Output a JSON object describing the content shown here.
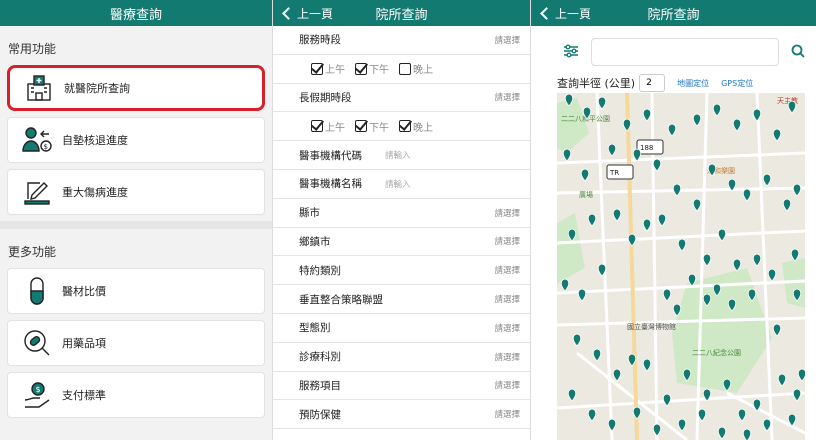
{
  "panel1": {
    "title": "醫療查詢",
    "common_title": "常用功能",
    "common_items": [
      {
        "label": "就醫院所查詢"
      },
      {
        "label": "自墊核退進度"
      },
      {
        "label": "重大傷病進度"
      }
    ],
    "more_title": "更多功能",
    "more_items": [
      {
        "label": "醫材比價"
      },
      {
        "label": "用藥品項"
      },
      {
        "label": "支付標準"
      }
    ]
  },
  "panel2": {
    "back_label": "上一頁",
    "title": "院所查詢",
    "service_time": {
      "label": "服務時段",
      "value": "請選擇",
      "options": [
        "上午",
        "下午",
        "晚上"
      ]
    },
    "holiday_time": {
      "label": "長假期時段",
      "value": "請選擇",
      "options": [
        "上午",
        "下午",
        "晚上"
      ]
    },
    "fields": [
      {
        "label": "醫事機構代碼",
        "value": "請輸入",
        "type": "input"
      },
      {
        "label": "醫事機構名稱",
        "value": "請輸入",
        "type": "input"
      },
      {
        "label": "縣市",
        "value": "請選擇",
        "type": "select"
      },
      {
        "label": "鄉鎮市",
        "value": "請選擇",
        "type": "select"
      },
      {
        "label": "特約類別",
        "value": "請選擇",
        "type": "select"
      },
      {
        "label": "垂直整合策略聯盟",
        "value": "請選擇",
        "type": "select"
      },
      {
        "label": "型態別",
        "value": "請選擇",
        "type": "select"
      },
      {
        "label": "診療科別",
        "value": "請選擇",
        "type": "select"
      },
      {
        "label": "服務項目",
        "value": "請選擇",
        "type": "select"
      },
      {
        "label": "預防保健",
        "value": "請選擇",
        "type": "select"
      }
    ]
  },
  "panel3": {
    "back_label": "上一頁",
    "title": "院所查詢",
    "radius_label": "查詢半徑 (公里)",
    "radius_value": "2",
    "map_locate": "地圖定位",
    "gps_locate": "GPS定位",
    "map_labels": {
      "park1": "二二八和平公園",
      "park2": "二二八紀念公園",
      "museum": "國立臺灣博物館",
      "temple": "天主教",
      "area": "永和樂園",
      "mrt": "TR",
      "sign": "188",
      "square": "廣場"
    },
    "colors": {
      "header": "#137a72",
      "pin": "#137a72",
      "park": "#cfe8c5",
      "highlight": "#d7212a"
    }
  }
}
